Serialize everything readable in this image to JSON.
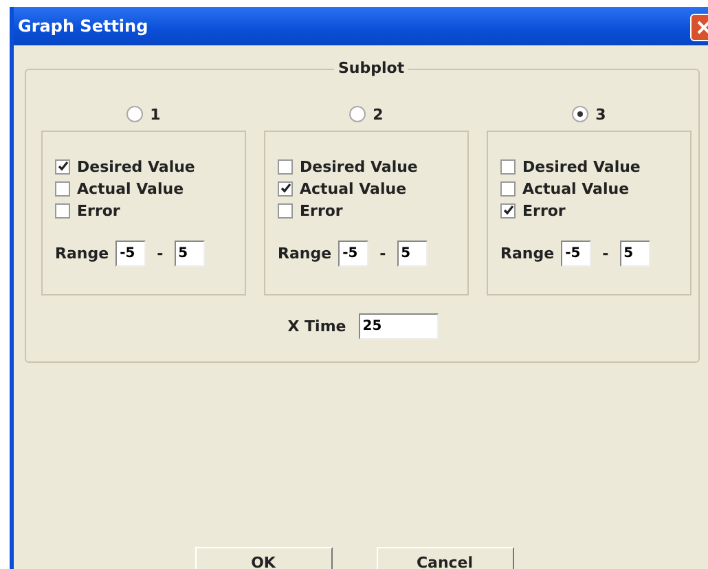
{
  "window": {
    "title": "Graph Setting"
  },
  "subplot": {
    "title": "Subplot",
    "panels": [
      {
        "label": "1",
        "selected": false,
        "options": [
          {
            "label": "Desired Value",
            "checked": true
          },
          {
            "label": "Actual Value",
            "checked": false
          },
          {
            "label": "Error",
            "checked": false
          }
        ],
        "range_label": "Range",
        "range_min": "-5",
        "range_sep": "-",
        "range_max": "5"
      },
      {
        "label": "2",
        "selected": false,
        "options": [
          {
            "label": "Desired Value",
            "checked": false
          },
          {
            "label": "Actual Value",
            "checked": true
          },
          {
            "label": "Error",
            "checked": false
          }
        ],
        "range_label": "Range",
        "range_min": "-5",
        "range_sep": "-",
        "range_max": "5"
      },
      {
        "label": "3",
        "selected": true,
        "options": [
          {
            "label": "Desired Value",
            "checked": false
          },
          {
            "label": "Actual Value",
            "checked": false
          },
          {
            "label": "Error",
            "checked": true
          }
        ],
        "range_label": "Range",
        "range_min": "-5",
        "range_sep": "-",
        "range_max": "5"
      }
    ],
    "x_time_label": "X Time",
    "x_time": "25"
  },
  "buttons": [
    "OK",
    "Cancel"
  ]
}
